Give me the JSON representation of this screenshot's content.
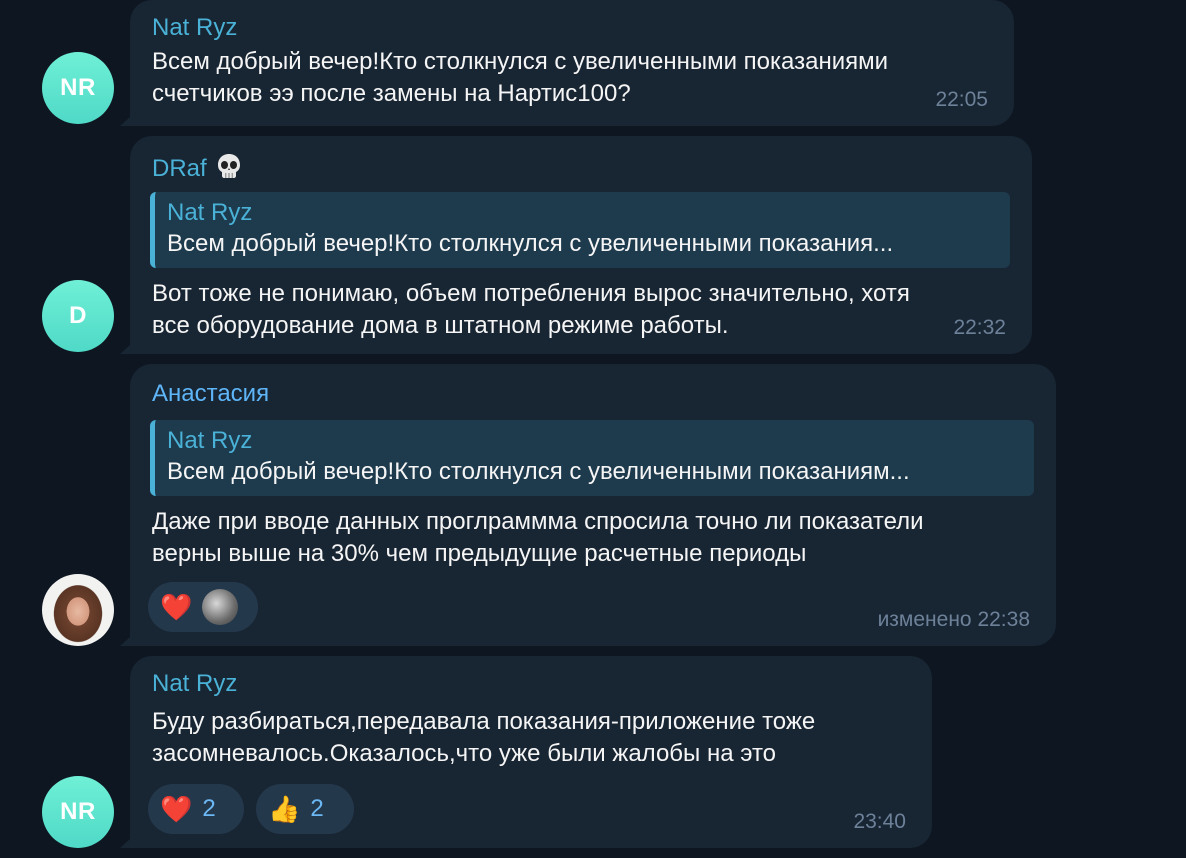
{
  "messages": [
    {
      "avatar_initials": "NR",
      "sender": "Nat Ryz",
      "text": "Всем добрый вечер!Кто столкнулся с увеличенными показаниями\nсчетчиков ээ после замены на Нартис100?",
      "time": "22:05"
    },
    {
      "avatar_initials": "D",
      "sender": "DRaf",
      "sender_emoji": "skull-icon",
      "reply": {
        "sender": "Nat Ryz",
        "text": "Всем добрый вечер!Кто столкнулся с увеличенными показания..."
      },
      "text": "Вот тоже не понимаю, объем потребления вырос значительно, хотя\nвсе оборудование дома в штатном режиме работы.",
      "time": "22:32"
    },
    {
      "avatar_initials": "",
      "sender": "Анастасия",
      "reply": {
        "sender": "Nat Ryz",
        "text": "Всем добрый вечер!Кто столкнулся с увеличенными показаниям..."
      },
      "text": "Даже при вводе данных проглраммма спросила точно ли показатели\nверны  выше на 30% чем предыдущие расчетные периоды",
      "reactions": [
        {
          "emoji": "red-heart",
          "glyph": "❤️",
          "reactor_avatar": true
        }
      ],
      "time": "изменено 22:38"
    },
    {
      "avatar_initials": "NR",
      "sender": "Nat Ryz",
      "text": "Буду разбираться,передавала показания-приложение тоже\nзасомневалось.Оказалось,что уже были жалобы на это",
      "reactions": [
        {
          "emoji": "red-heart",
          "glyph": "❤️",
          "count": "2"
        },
        {
          "emoji": "thumbs-up",
          "glyph": "👍",
          "count": "2"
        }
      ],
      "time": "23:40"
    }
  ],
  "colors": {
    "background": "#0e1621",
    "bubble": "#182533",
    "avatar_mint": "#5fe3cd",
    "sender_blue": "#5eb5f7",
    "sender_teal": "#4ab1d7",
    "time": "#6d8199"
  }
}
